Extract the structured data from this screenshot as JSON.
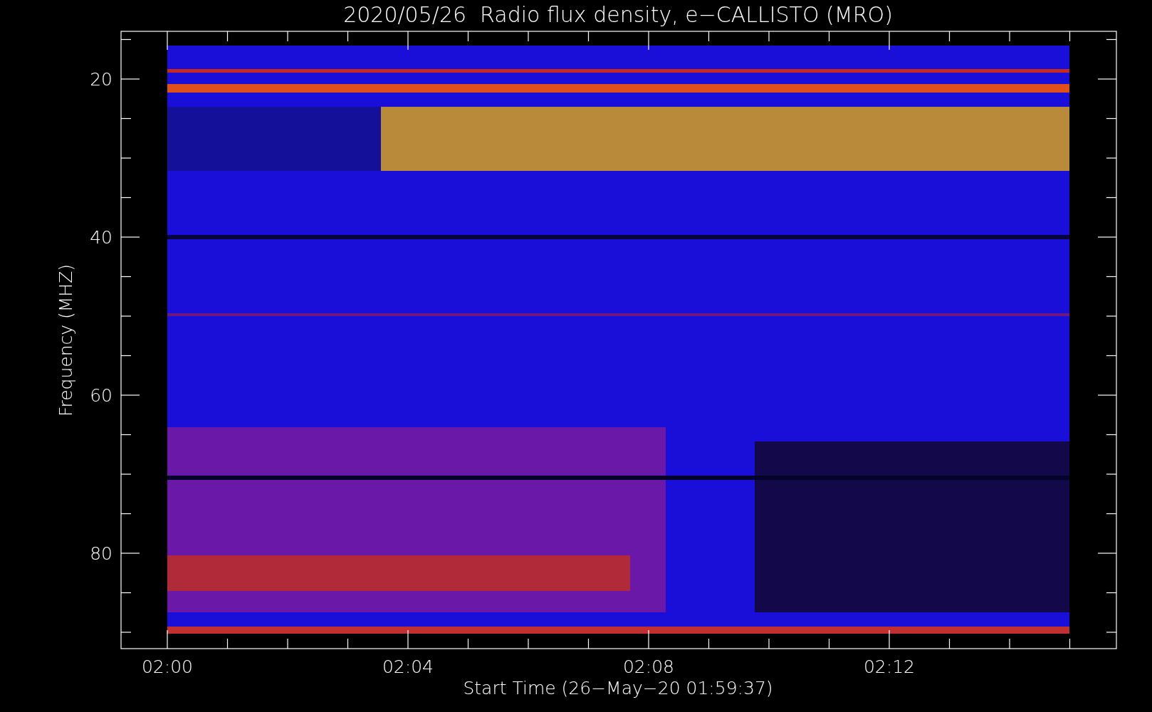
{
  "title": "2020/05/26  Radio flux density, e−CALLISTO (MRO)",
  "y_axis": {
    "label": "Frequency (MHZ)",
    "tick_labels": [
      "20",
      "40",
      "60",
      "80"
    ]
  },
  "x_axis": {
    "label": "Start Time (26−May−20 01:59:37)",
    "tick_labels": [
      "02:00",
      "02:04",
      "02:08",
      "02:12"
    ]
  }
}
